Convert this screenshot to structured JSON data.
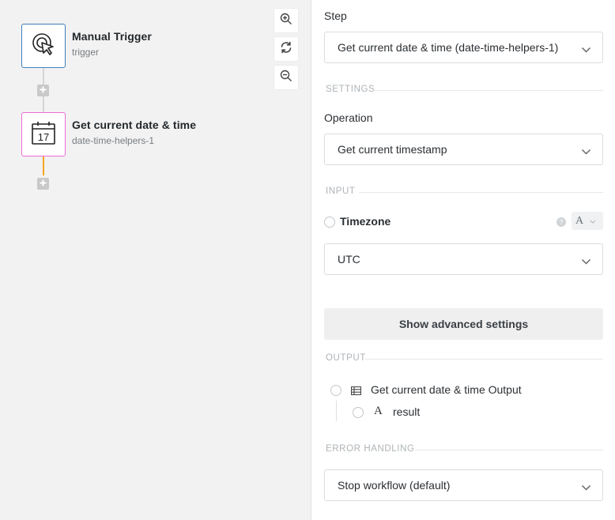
{
  "canvas": {
    "nodes": [
      {
        "title": "Manual Trigger",
        "subtitle": "trigger",
        "icon": "cursor-click-icon",
        "border_color": "#3e7fb9"
      },
      {
        "title": "Get current date & time",
        "subtitle": "date-time-helpers-1",
        "icon": "calendar-icon",
        "calendar_day": "17",
        "border_color": "#f06cd8"
      }
    ],
    "connector_color_active": "#f5a623",
    "zoom_controls": [
      "zoom-in-icon",
      "refresh-icon",
      "zoom-out-icon"
    ]
  },
  "panel": {
    "step_label": "Step",
    "step_value": "Get current date & time (date-time-helpers-1)",
    "settings_section": "SETTINGS",
    "operation_label": "Operation",
    "operation_value": "Get current timestamp",
    "input_section": "INPUT",
    "timezone_label": "Timezone",
    "type_badge": "A",
    "timezone_value": "UTC",
    "advanced_button": "Show advanced settings",
    "output_section": "OUTPUT",
    "output_root": "Get current date & time Output",
    "output_child_icon": "A",
    "output_child": "result",
    "error_section": "ERROR HANDLING",
    "error_value": "Stop workflow (default)"
  }
}
